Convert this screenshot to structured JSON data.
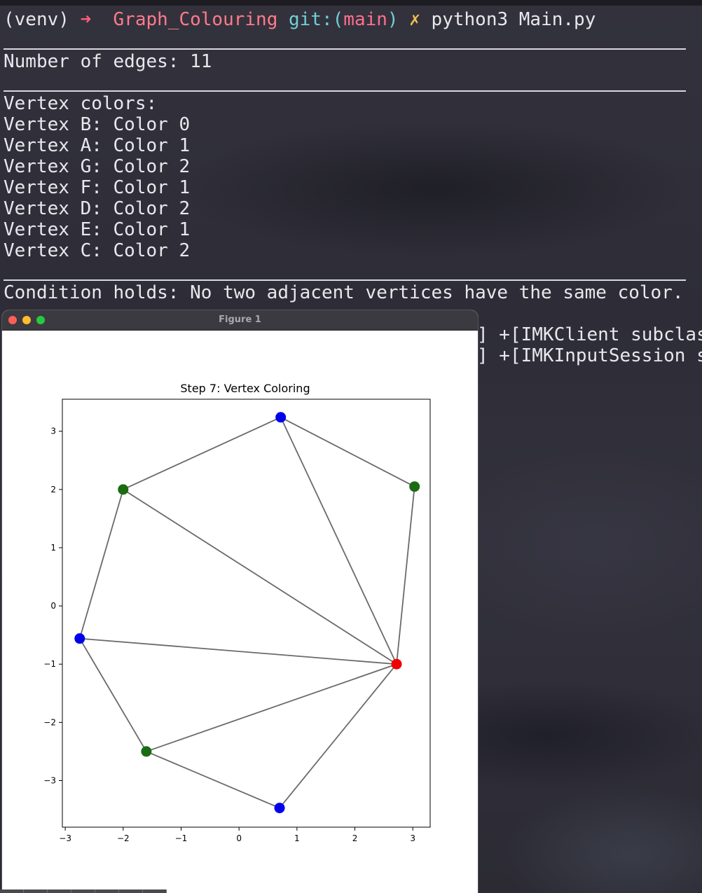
{
  "terminal": {
    "prompt_venv": "(venv)",
    "prompt_arrow": "➜",
    "prompt_dir": "Graph_Colouring",
    "prompt_git": "git:(",
    "prompt_branch": "main",
    "prompt_git_close": ")",
    "prompt_dirty": "✗",
    "command": "python3 Main.py",
    "edges_line": "Number of edges: 11",
    "vertex_colors_header": "Vertex colors:",
    "vertex_lines": [
      "Vertex B: Color 0",
      "Vertex A: Color 1",
      "Vertex G: Color 2",
      "Vertex F: Color 1",
      "Vertex D: Color 2",
      "Vertex E: Color 1",
      "Vertex C: Color 2"
    ],
    "condition_line": "Condition holds: No two adjacent vertices have the same color.",
    "partial_lines": [
      "] +[IMKClient subclass",
      "] +[IMKInputSession su"
    ]
  },
  "figure_window": {
    "title": "Figure 1"
  },
  "chart_data": {
    "type": "scatter",
    "title": "Step 7: Vertex Coloring",
    "xlabel": "",
    "ylabel": "",
    "xlim": [
      -3.05,
      3.3
    ],
    "ylim": [
      -3.8,
      3.55
    ],
    "xticks": [
      -3,
      -2,
      -1,
      0,
      1,
      2,
      3
    ],
    "yticks": [
      -3,
      -2,
      -1,
      0,
      1,
      2,
      3
    ],
    "xtick_labels": [
      "−3",
      "−2",
      "−1",
      "0",
      "1",
      "2",
      "3"
    ],
    "ytick_labels": [
      "−3",
      "−2",
      "−1",
      "0",
      "1",
      "2",
      "3"
    ],
    "grid": false,
    "edge_color": "#6a6a6a",
    "nodes": [
      {
        "x": 0.72,
        "y": 3.24,
        "color": "#0000ee"
      },
      {
        "x": -2.0,
        "y": 2.0,
        "color": "#1a6b12"
      },
      {
        "x": 3.03,
        "y": 2.05,
        "color": "#1a6b12"
      },
      {
        "x": -2.75,
        "y": -0.56,
        "color": "#0000ee"
      },
      {
        "x": 2.72,
        "y": -1.0,
        "color": "#ee0000"
      },
      {
        "x": -1.6,
        "y": -2.5,
        "color": "#1a6b12"
      },
      {
        "x": 0.7,
        "y": -3.47,
        "color": "#0000ee"
      }
    ],
    "edges": [
      [
        0,
        1
      ],
      [
        0,
        2
      ],
      [
        0,
        4
      ],
      [
        1,
        3
      ],
      [
        1,
        4
      ],
      [
        2,
        4
      ],
      [
        3,
        4
      ],
      [
        3,
        5
      ],
      [
        5,
        4
      ],
      [
        5,
        6
      ],
      [
        6,
        4
      ]
    ]
  }
}
